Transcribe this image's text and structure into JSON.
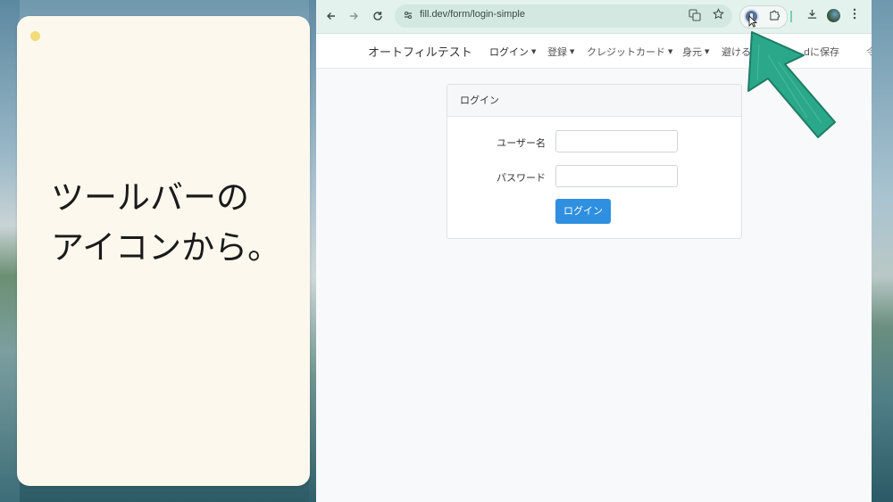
{
  "caption": {
    "line1": "ツールバーの",
    "line2": "アイコンから。"
  },
  "browser": {
    "url": "fill.dev/form/login-simple",
    "icons": {
      "back": "arrow-left-icon",
      "forward": "arrow-right-icon",
      "reload": "reload-icon",
      "site_settings": "tune-icon",
      "translate": "translate-icon",
      "bookmark": "star-icon",
      "extension_autofill": "autofill-extension-icon",
      "extensions": "puzzle-icon",
      "downloads": "download-icon",
      "profile": "avatar-icon",
      "menu": "kebab-menu-icon"
    },
    "separator_color": "#78d0b4"
  },
  "site": {
    "brand": "オートフィルテスト",
    "nav": [
      {
        "label": "ログイン",
        "dropdown": true
      },
      {
        "label": "登録",
        "dropdown": true
      },
      {
        "label": "クレジットカード",
        "dropdown": true
      },
      {
        "label": "身元",
        "dropdown": true
      },
      {
        "label": "避ける",
        "dropdown": false
      },
      {
        "label": "dに保存",
        "dropdown": false
      }
    ],
    "nav_overflow": "令",
    "caret": "▼"
  },
  "login": {
    "title": "ログイン",
    "username_label": "ユーザー名",
    "password_label": "パスワード",
    "submit_label": "ログイン",
    "accent_color": "#2f8fe0"
  },
  "annotation": {
    "arrow_color": "#2aa889",
    "target": "autofill-extension-icon"
  }
}
